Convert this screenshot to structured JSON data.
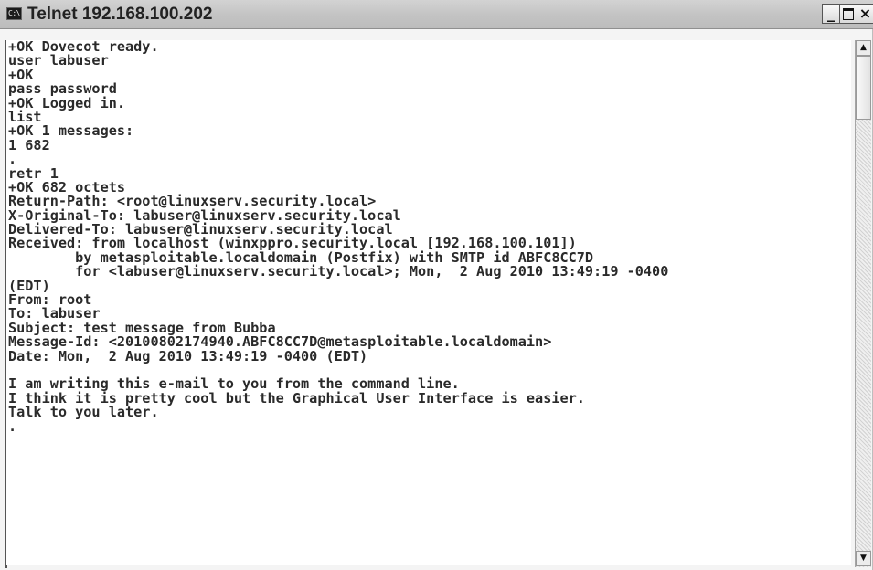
{
  "window": {
    "icon_label": "C:\\",
    "title": "Telnet 192.168.100.202",
    "minimize_symbol": "_",
    "close_symbol": "×"
  },
  "terminal": {
    "lines": [
      "+OK Dovecot ready.",
      "user labuser",
      "+OK",
      "pass password",
      "+OK Logged in.",
      "list",
      "+OK 1 messages:",
      "1 682",
      ".",
      "retr 1",
      "+OK 682 octets",
      "Return-Path: <root@linuxserv.security.local>",
      "X-Original-To: labuser@linuxserv.security.local",
      "Delivered-To: labuser@linuxserv.security.local",
      "Received: from localhost (winxppro.security.local [192.168.100.101])",
      "        by metasploitable.localdomain (Postfix) with SMTP id ABFC8CC7D",
      "        for <labuser@linuxserv.security.local>; Mon,  2 Aug 2010 13:49:19 -0400",
      "(EDT)",
      "From: root",
      "To: labuser",
      "Subject: test message from Bubba",
      "Message-Id: <20100802174940.ABFC8CC7D@metasploitable.localdomain>",
      "Date: Mon,  2 Aug 2010 13:49:19 -0400 (EDT)",
      "",
      "I am writing this e-mail to you from the command line.",
      "I think it is pretty cool but the Graphical User Interface is easier.",
      "Talk to you later.",
      "."
    ]
  },
  "scrollbar": {
    "up_arrow": "▲",
    "down_arrow": "▼"
  }
}
